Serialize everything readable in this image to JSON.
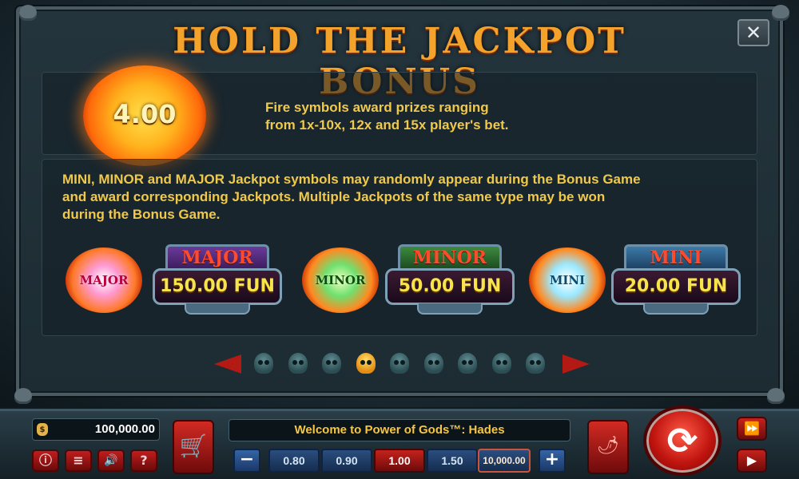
{
  "title": "HOLD THE JACKPOT BONUS",
  "close_label": "✕",
  "fire_symbol": {
    "value": "4.00",
    "lines": [
      "Fire symbols award prizes ranging",
      "from 1x-10x, 12x and 15x player's bet."
    ]
  },
  "jackpot_text": [
    "MINI, MINOR and MAJOR Jackpot symbols may randomly appear during the Bonus Game",
    "and award corresponding Jackpots. Multiple Jackpots of the same type may be won",
    "during the Bonus Game."
  ],
  "jackpots": [
    {
      "orb_label": "MAJOR",
      "name": "MAJOR",
      "amount": "150.00 FUN"
    },
    {
      "orb_label": "MINOR",
      "name": "MINOR",
      "amount": "50.00 FUN"
    },
    {
      "orb_label": "MINI",
      "name": "MINI",
      "amount": "20.00 FUN"
    }
  ],
  "pagination": {
    "total": 9,
    "active_index": 3
  },
  "bottom_bar": {
    "balance": "100,000.00",
    "message": "Welcome to Power of Gods™: Hades",
    "bets": [
      "0.80",
      "0.90",
      "1.00",
      "1.50",
      "10,000.00"
    ],
    "selected_bet": "1.00",
    "buttons": {
      "info": "ⓘ",
      "menu": "≡",
      "sound": "🔊",
      "help": "?",
      "minus": "−",
      "plus": "+"
    }
  },
  "icons": {
    "close": "close-icon",
    "shop": "cart-icon",
    "balance": "money-bag-icon",
    "chili": "chili-icon",
    "spin": "spin-icon",
    "autoplay": "autoplay-icon",
    "turbo": "turbo-icon"
  },
  "colors": {
    "title": "#f3a32c",
    "body_text": "#f1c94a",
    "accent_red": "#c0140f",
    "active_page_dot": "#e48b10"
  }
}
